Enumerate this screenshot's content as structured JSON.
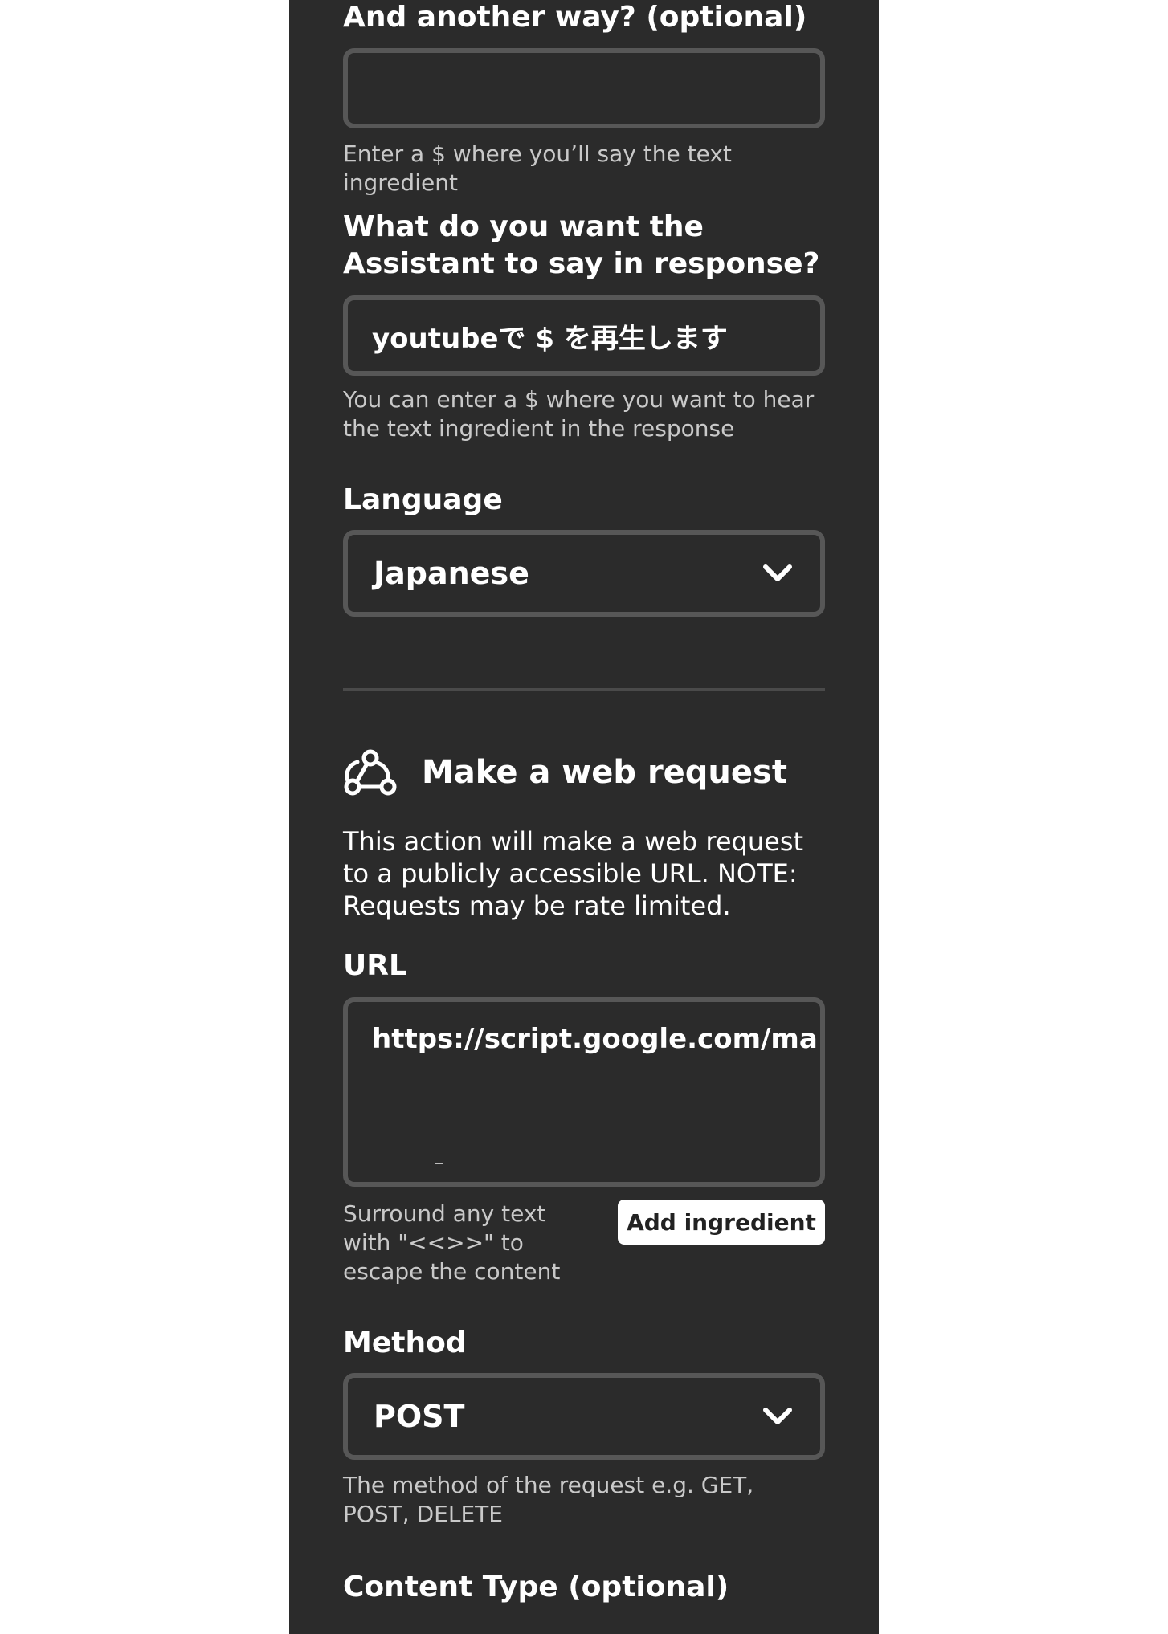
{
  "alt_phrase": {
    "label": "And another way? (optional)",
    "value": "",
    "helper": "Enter a $ where you’ll say the text ingredient"
  },
  "response": {
    "label": "What do you want the Assistant to say in response?",
    "value": "youtubeで $ を再生します",
    "helper": "You can enter a $ where you want to hear the text ingredient in the response"
  },
  "language": {
    "label": "Language",
    "selected": "Japanese",
    "icon": "chevron-down-icon"
  },
  "web_request": {
    "icon": "webhook-icon",
    "title": "Make a web request",
    "description": "This action will make a web request to a publicly accessible URL. NOTE: Requests may be rate limited.",
    "url": {
      "label": "URL",
      "value": "https://script.google.com/ma",
      "helper": "Surround any text with \"<<>>\" to escape the content",
      "add_button": "Add ingredient"
    },
    "method": {
      "label": "Method",
      "selected": "POST",
      "helper": "The method of the request e.g. GET, POST, DELETE",
      "icon": "chevron-down-icon"
    },
    "content_type": {
      "label": "Content Type (optional)"
    }
  },
  "colors": {
    "panel_bg": "#2b2b2b",
    "field_border": "#575757",
    "helper_text": "#c9c9c9",
    "button_bg": "#ffffff"
  }
}
